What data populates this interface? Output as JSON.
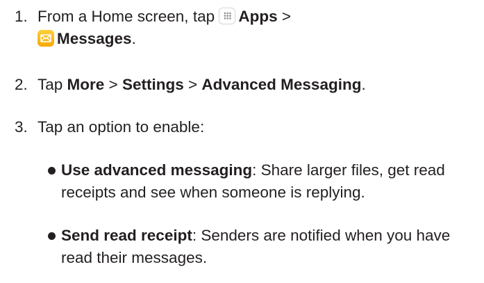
{
  "steps": [
    {
      "number": "1.",
      "text_before": "From a Home screen, tap ",
      "apps_label": "Apps",
      "sep": " >",
      "messages_label": "Messages",
      "end": "."
    },
    {
      "number": "2.",
      "text_before": "Tap ",
      "more": "More",
      "sep1": " > ",
      "settings": "Settings",
      "sep2": " > ",
      "advanced": "Advanced Messaging",
      "end": "."
    },
    {
      "number": "3.",
      "text": "Tap an option to enable:"
    }
  ],
  "options": [
    {
      "title": "Use advanced messaging",
      "description": ": Share larger files, get read receipts and see when someone is replying."
    },
    {
      "title": "Send read receipt",
      "description": ": Senders are notified when you have read their messages."
    }
  ],
  "icons": {
    "apps": "apps-grid-icon",
    "messages": "messages-envelope-icon"
  },
  "colors": {
    "text": "#231f20",
    "messages_icon": "#f7a800"
  }
}
